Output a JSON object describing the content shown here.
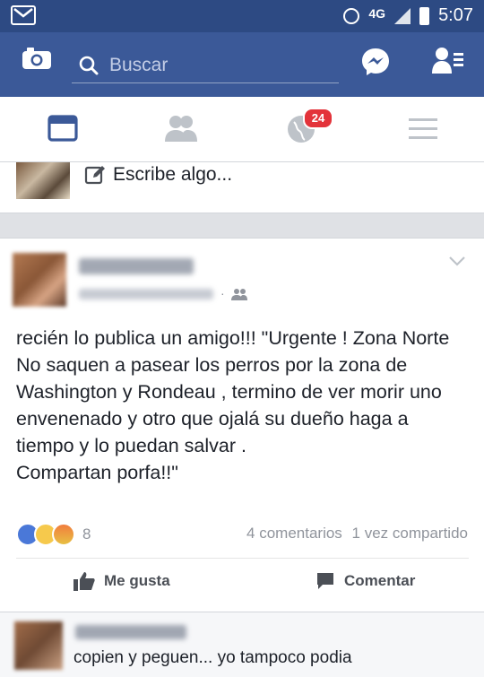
{
  "status_bar": {
    "network": "4G",
    "time": "5:07",
    "icons": [
      "gmail-icon",
      "alarm-icon",
      "signal-icon",
      "battery-icon"
    ]
  },
  "top_bar": {
    "search_placeholder": "Buscar",
    "icons": [
      "camera-icon",
      "search-icon",
      "messenger-icon",
      "friend-requests-icon"
    ],
    "color": "#3b5998"
  },
  "tabs": [
    {
      "name": "news-feed",
      "icon": "newsfeed-icon",
      "active": true
    },
    {
      "name": "friends",
      "icon": "friends-icon",
      "active": false
    },
    {
      "name": "notifications",
      "icon": "globe-icon",
      "badge": "24",
      "active": false
    },
    {
      "name": "menu",
      "icon": "hamburger-menu-icon",
      "active": false
    }
  ],
  "composer": {
    "placeholder": "Escribe algo..."
  },
  "post": {
    "text": "recién lo publica un amigo!!! \"Urgente ! Zona Norte\nNo saquen a pasear los perros por la zona de Washington y Rondeau , termino de ver morir uno envenenado y otro que ojalá su dueño haga a tiempo y lo puedan salvar .\nCompartan porfa!!\"",
    "reaction_count": "8",
    "comments": "4 comentarios",
    "shares": "1 vez compartido",
    "like_label": "Me gusta",
    "comment_label": "Comentar"
  },
  "comment_preview": {
    "text": "copien y peguen... yo tampoco podia"
  }
}
